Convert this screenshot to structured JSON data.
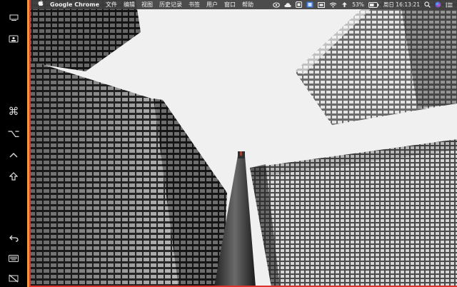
{
  "menubar": {
    "apple_icon": "apple-logo-icon",
    "app_name": "Google Chrome",
    "menus": [
      "文件",
      "编辑",
      "视图",
      "历史记录",
      "书签",
      "用户",
      "窗口",
      "帮助"
    ],
    "status": {
      "battery_percent": "53%",
      "clock": "周日 16:13:21"
    }
  },
  "sidebar": {
    "buttons": [
      "display-icon",
      "screen-sidecar-icon",
      "command-key-icon",
      "option-key-icon",
      "control-key-icon",
      "shift-key-icon",
      "undo-icon",
      "keyboard-icon",
      "disconnect-sidecar-icon"
    ]
  },
  "wallpaper": {
    "subject": "low-angle-skyscrapers-bw"
  },
  "colors": {
    "menubar_bg": "#3e3e3e",
    "frame_orange": "#f29a2e",
    "frame_red": "#e0322c",
    "sky": "#f0f0f0"
  }
}
